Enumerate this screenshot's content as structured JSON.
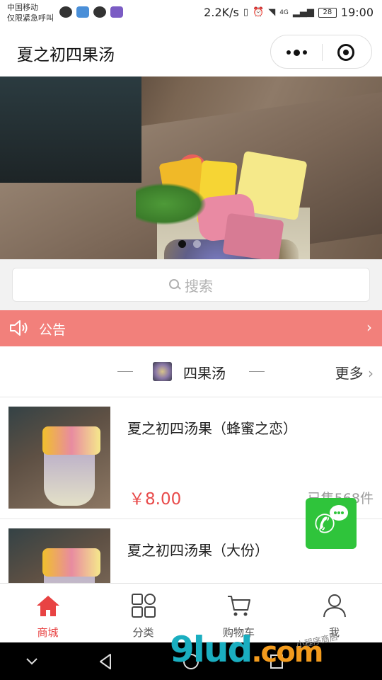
{
  "status_bar": {
    "carrier": "中国移动",
    "emergency": "仅限紧急呼叫",
    "speed": "2.2K/s",
    "network": "4G",
    "battery": "28",
    "time": "19:00"
  },
  "nav": {
    "title": "夏之初四果汤"
  },
  "banner": {
    "slide_count": 2,
    "active_slide": 0
  },
  "search": {
    "placeholder": "搜索"
  },
  "notice": {
    "label": "公告"
  },
  "section": {
    "title": "四果汤",
    "more": "更多"
  },
  "products": [
    {
      "name": "夏之初四汤果（蜂蜜之恋）",
      "price": "￥8.00",
      "sold": "已售568件"
    },
    {
      "name": "夏之初四汤果（大份）"
    }
  ],
  "tabs": [
    {
      "label": "商城",
      "icon": "home-icon",
      "active": true
    },
    {
      "label": "分类",
      "icon": "category-icon"
    },
    {
      "label": "购物车",
      "icon": "cart-icon"
    },
    {
      "label": "我",
      "icon": "user-icon"
    }
  ],
  "watermark": {
    "main": "9lud",
    "suffix": ".com",
    "small": "小程序商店"
  },
  "colors": {
    "accent": "#e84343",
    "notice_bg": "#f2807b",
    "call_green": "#2fc43b"
  }
}
